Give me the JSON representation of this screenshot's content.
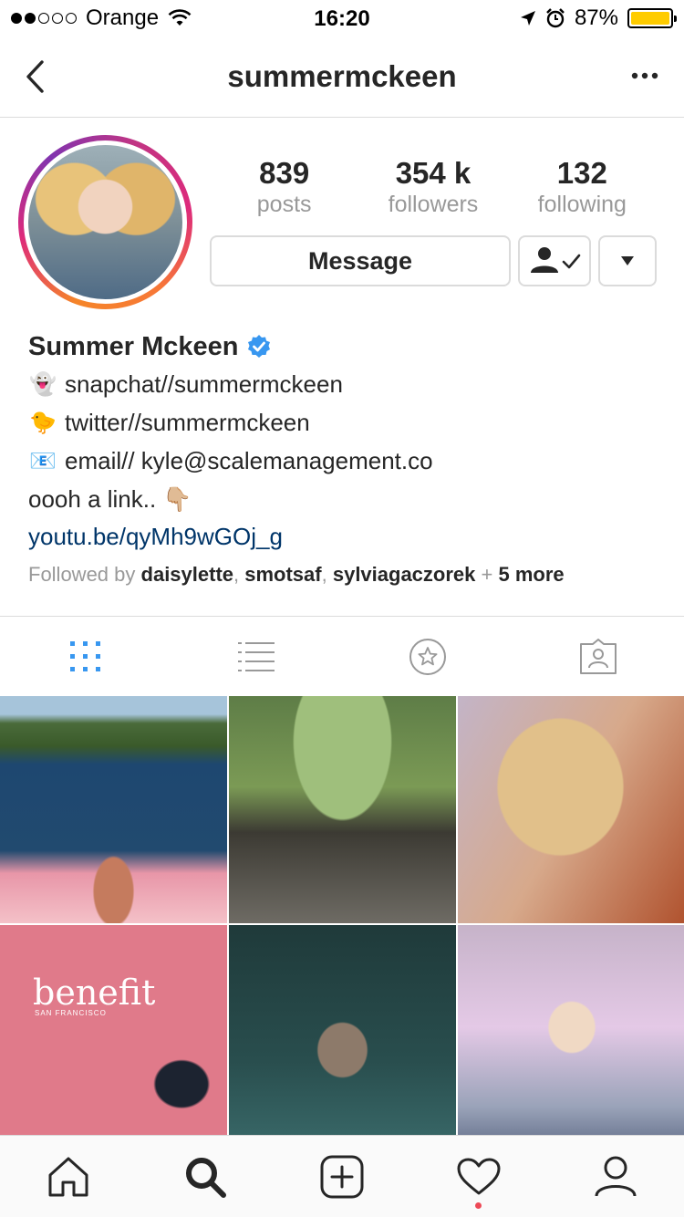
{
  "status_bar": {
    "carrier": "Orange",
    "time": "16:20",
    "battery": "87%"
  },
  "nav": {
    "title": "summermckeen"
  },
  "profile": {
    "stats": [
      {
        "value": "839",
        "label": "posts"
      },
      {
        "value": "354 k",
        "label": "followers"
      },
      {
        "value": "132",
        "label": "following"
      }
    ],
    "message_button": "Message",
    "name": "Summer Mckeen",
    "bio": [
      {
        "emoji": "👻",
        "text": "snapchat//summermckeen"
      },
      {
        "emoji": "🐤",
        "text": "twitter//summermckeen"
      },
      {
        "emoji": "📧",
        "text": "email// kyle@scalemanagement.co"
      },
      {
        "emoji": "",
        "text": "oooh a link.. 👇🏼"
      }
    ],
    "link": "youtu.be/qyMh9wGOj_g",
    "followed_by": {
      "prefix": "Followed by",
      "names": [
        "daisylette",
        "smotsaf",
        "sylviagaczorek"
      ],
      "separators": [
        ", ",
        ", ",
        " + "
      ],
      "more": "5 more"
    }
  },
  "grid": {
    "benefit_text": "benefit",
    "benefit_sub": "SAN FRANCISCO"
  },
  "colors": {
    "accent": "#3897f0",
    "link": "#003569",
    "notification": "#ed4956",
    "battery": "#ffcc00"
  },
  "tabs": [
    "grid-view-icon",
    "list-view-icon",
    "saved-star-icon",
    "tagged-photos-icon"
  ],
  "tabbar": [
    "home-icon",
    "search-icon",
    "add-post-icon",
    "activity-heart-icon",
    "profile-icon"
  ]
}
